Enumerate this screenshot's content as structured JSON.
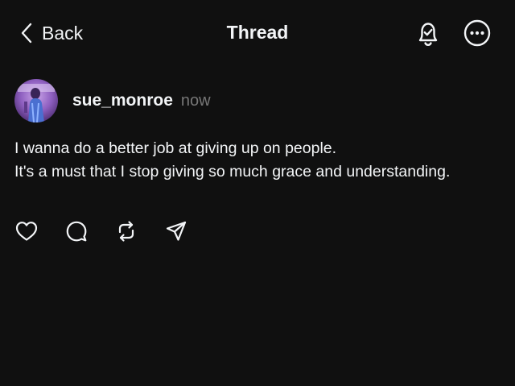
{
  "nav": {
    "back_label": "Back",
    "title": "Thread",
    "icons": [
      "bell-check-icon",
      "more-icon"
    ]
  },
  "post": {
    "username": "sue_monroe",
    "timestamp": "now",
    "lines": [
      "I wanna do a better job at giving up on people.",
      "It's a must that I stop giving so much grace and understanding."
    ],
    "actions": [
      "heart-icon",
      "comment-icon",
      "repost-icon",
      "share-icon"
    ]
  },
  "colors": {
    "background": "#101010",
    "text": "#f3f5f7",
    "muted": "#777777"
  }
}
